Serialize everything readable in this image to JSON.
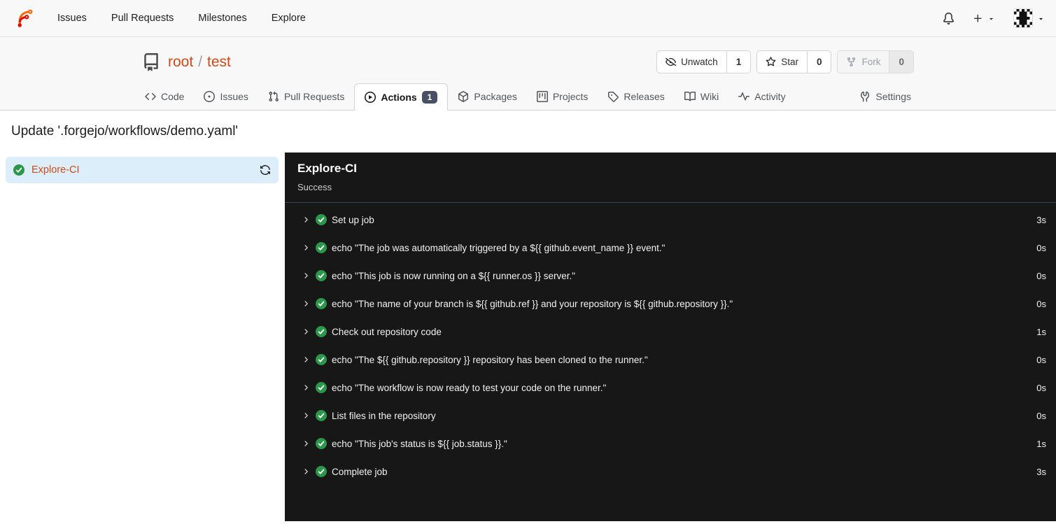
{
  "navbar": {
    "links": [
      "Issues",
      "Pull Requests",
      "Milestones",
      "Explore"
    ]
  },
  "repo_header": {
    "owner": "root",
    "separator": "/",
    "name": "test",
    "watch": {
      "label": "Unwatch",
      "count": "1"
    },
    "star": {
      "label": "Star",
      "count": "0"
    },
    "fork": {
      "label": "Fork",
      "count": "0"
    }
  },
  "tabs": {
    "code": "Code",
    "issues": "Issues",
    "pull_requests": "Pull Requests",
    "actions": "Actions",
    "actions_badge": "1",
    "packages": "Packages",
    "projects": "Projects",
    "releases": "Releases",
    "wiki": "Wiki",
    "activity": "Activity",
    "settings": "Settings"
  },
  "run": {
    "title": "Update '.forgejo/workflows/demo.yaml'",
    "job_name": "Explore-CI",
    "status": "Success",
    "steps": [
      {
        "name": "Set up job",
        "duration": "3s"
      },
      {
        "name": "echo \"The job was automatically triggered by a ${{ github.event_name }} event.\"",
        "duration": "0s"
      },
      {
        "name": "echo \"This job is now running on a ${{ runner.os }} server.\"",
        "duration": "0s"
      },
      {
        "name": "echo \"The name of your branch is ${{ github.ref }} and your repository is ${{ github.repository }}.\"",
        "duration": "0s"
      },
      {
        "name": "Check out repository code",
        "duration": "1s"
      },
      {
        "name": "echo \"The ${{ github.repository }} repository has been cloned to the runner.\"",
        "duration": "0s"
      },
      {
        "name": "echo \"The workflow is now ready to test your code on the runner.\"",
        "duration": "0s"
      },
      {
        "name": "List files in the repository",
        "duration": "0s"
      },
      {
        "name": "echo \"This job's status is ${{ job.status }}.\"",
        "duration": "1s"
      },
      {
        "name": "Complete job",
        "duration": "3s"
      }
    ]
  },
  "colors": {
    "link_orange": "#cc4b1e",
    "success_green": "#2c974b",
    "panel_dark": "#171717",
    "selected_job_bg": "#ddeefb",
    "badge_bg": "#4a5064"
  }
}
